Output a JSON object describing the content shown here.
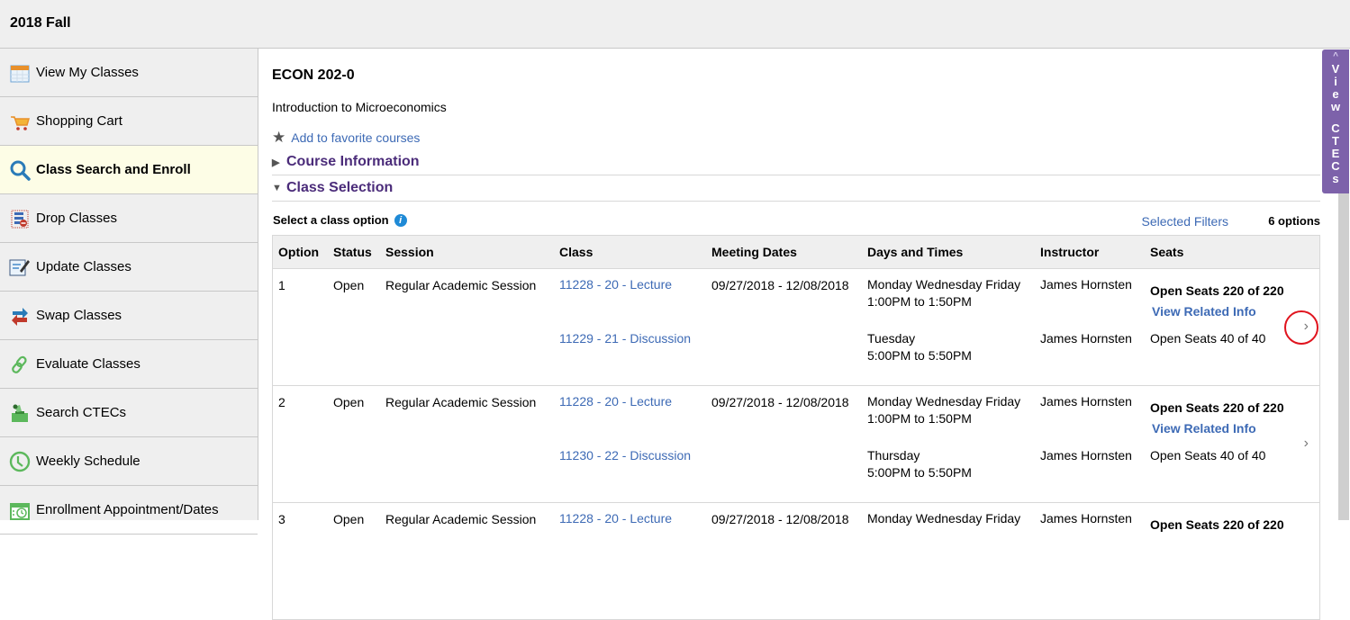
{
  "header": {
    "term": "2018 Fall"
  },
  "sidebar": {
    "items": [
      {
        "label": "View My Classes",
        "icon": "calendar-icon",
        "active": false
      },
      {
        "label": "Shopping Cart",
        "icon": "cart-icon",
        "active": false
      },
      {
        "label": "Class Search and Enroll",
        "icon": "search-icon",
        "active": true
      },
      {
        "label": "Drop Classes",
        "icon": "drop-list-icon",
        "active": false
      },
      {
        "label": "Update Classes",
        "icon": "edit-document-icon",
        "active": false
      },
      {
        "label": "Swap Classes",
        "icon": "swap-arrows-icon",
        "active": false
      },
      {
        "label": "Evaluate Classes",
        "icon": "link-icon",
        "active": false
      },
      {
        "label": "Search CTECs",
        "icon": "ballot-box-icon",
        "active": false
      },
      {
        "label": "Weekly Schedule",
        "icon": "clock-icon",
        "active": false
      },
      {
        "label": "Enrollment Appointment/Dates",
        "icon": "calendar-check-icon",
        "active": false
      }
    ]
  },
  "course": {
    "code": "ECON 202-0",
    "title": "Introduction to Microeconomics",
    "favorite_label": "Add to favorite courses",
    "course_info_label": "Course Information",
    "class_selection_label": "Class Selection"
  },
  "options": {
    "prompt": "Select a class option",
    "filters_label": "Selected Filters",
    "count_label": "6 options"
  },
  "table": {
    "headers": [
      "Option",
      "Status",
      "Session",
      "Class",
      "Meeting Dates",
      "Days and Times",
      "Instructor",
      "Seats"
    ],
    "rows": [
      {
        "option": "1",
        "status": "Open",
        "session": "Regular Academic Session",
        "lecture": {
          "class": "11228 - 20 - Lecture",
          "dates": "09/27/2018 - 12/08/2018",
          "days": "Monday Wednesday Friday",
          "time": "1:00PM to 1:50PM",
          "instructor": "James Hornsten",
          "seats": "Open Seats 220 of 220"
        },
        "related": "View Related Info",
        "discussion": {
          "class": "11229 - 21 - Discussion",
          "days": "Tuesday",
          "time": "5:00PM to 5:50PM",
          "instructor": "James Hornsten",
          "seats": "Open Seats 40 of 40"
        }
      },
      {
        "option": "2",
        "status": "Open",
        "session": "Regular Academic Session",
        "lecture": {
          "class": "11228 - 20 - Lecture",
          "dates": "09/27/2018 - 12/08/2018",
          "days": "Monday Wednesday Friday",
          "time": "1:00PM to 1:50PM",
          "instructor": "James Hornsten",
          "seats": "Open Seats 220 of 220"
        },
        "related": "View Related Info",
        "discussion": {
          "class": "11230 - 22 - Discussion",
          "days": "Thursday",
          "time": "5:00PM to 5:50PM",
          "instructor": "James Hornsten",
          "seats": "Open Seats 40 of 40"
        }
      },
      {
        "option": "3",
        "status": "Open",
        "session": "Regular Academic Session",
        "lecture": {
          "class": "11228 - 20 - Lecture",
          "dates": "09/27/2018 - 12/08/2018",
          "days": "Monday Wednesday Friday",
          "time": "",
          "instructor": "James Hornsten",
          "seats": "Open Seats 220 of 220"
        }
      }
    ]
  },
  "ctec_tab": {
    "label": "View CTECs"
  },
  "colors": {
    "link": "#3d6ab5",
    "section": "#4b2c7a",
    "ctec_tab": "#7d62aa",
    "active_nav": "#fdfde6",
    "annotation": "#e0141e"
  }
}
